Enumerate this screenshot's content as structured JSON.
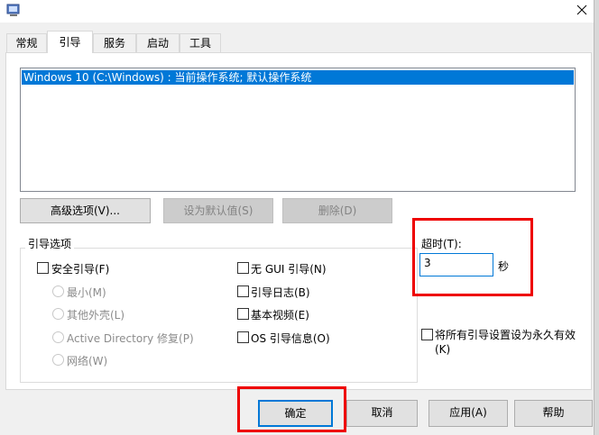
{
  "window": {
    "icon": "system-config-icon",
    "close_icon": "close-icon"
  },
  "tabs": [
    {
      "label": "常规"
    },
    {
      "label": "引导",
      "selected": true
    },
    {
      "label": "服务"
    },
    {
      "label": "启动"
    },
    {
      "label": "工具"
    }
  ],
  "boot_list": {
    "items": [
      "Windows 10 (C:\\Windows) : 当前操作系统; 默认操作系统"
    ]
  },
  "list_buttons": {
    "advanced": "高级选项(V)...",
    "set_default": "设为默认值(S)",
    "delete": "删除(D)"
  },
  "boot_options": {
    "title": "引导选项",
    "safe_boot": "安全引导(F)",
    "radios": [
      "最小(M)",
      "其他外壳(L)",
      "Active Directory 修复(P)",
      "网络(W)"
    ],
    "no_gui": "无 GUI 引导(N)",
    "boot_log": "引导日志(B)",
    "base_video": "基本视频(E)",
    "os_info": "OS 引导信息(O)"
  },
  "timeout": {
    "label": "超时(T):",
    "value": "3",
    "unit": "秒"
  },
  "permanent": {
    "line1": "将所有引导设置设为永久有效",
    "line2": "(K)"
  },
  "footer": {
    "ok": "确定",
    "cancel": "取消",
    "apply": "应用(A)",
    "help": "帮助"
  },
  "colors": {
    "selection": "#0078d7",
    "highlight": "#e00000"
  }
}
